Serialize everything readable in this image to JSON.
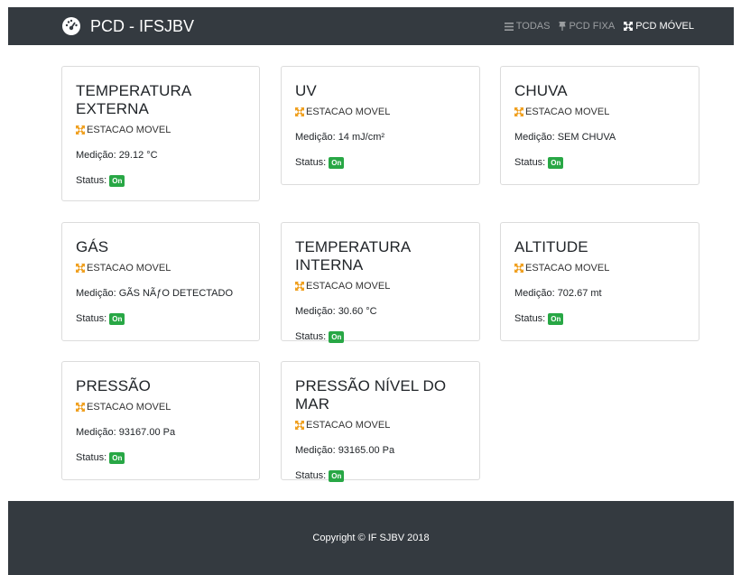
{
  "navbar": {
    "brand": "PCD - IFSJBV",
    "links": [
      {
        "label": "TODAS",
        "icon": "list-icon",
        "active": false
      },
      {
        "label": "PCD FIXA",
        "icon": "pin-icon",
        "active": false
      },
      {
        "label": "PCD MÓVEL",
        "icon": "arrows-icon",
        "active": true
      }
    ]
  },
  "cards": [
    {
      "title": "TEMPERATURA EXTERNA",
      "station": "ESTACAO MOVEL",
      "measure": "Medição: 29.12 °C",
      "status_label": "Status:",
      "status": "On"
    },
    {
      "title": "UV",
      "station": "ESTACAO MOVEL",
      "measure": "Medição: 14 mJ/cm²",
      "status_label": "Status:",
      "status": "On"
    },
    {
      "title": "CHUVA",
      "station": "ESTACAO MOVEL",
      "measure": "Medição: SEM CHUVA",
      "status_label": "Status:",
      "status": "On"
    },
    {
      "title": "GÁS",
      "station": "ESTACAO MOVEL",
      "measure": "Medição: GÃS NÃƒO DETECTADO",
      "status_label": "Status:",
      "status": "On"
    },
    {
      "title": "TEMPERATURA INTERNA",
      "station": "ESTACAO MOVEL",
      "measure": "Medição: 30.60 °C",
      "status_label": "Status:",
      "status": "On"
    },
    {
      "title": "ALTITUDE",
      "station": "ESTACAO MOVEL",
      "measure": "Medição: 702.67 mt",
      "status_label": "Status:",
      "status": "On"
    },
    {
      "title": "PRESSÃO",
      "station": "ESTACAO MOVEL",
      "measure": "Medição: 93167.00 Pa",
      "status_label": "Status:",
      "status": "On"
    },
    {
      "title": "PRESSÃO NÍVEL DO MAR",
      "station": "ESTACAO MOVEL",
      "measure": "Medição: 93165.00 Pa",
      "status_label": "Status:",
      "status": "On"
    }
  ],
  "colors": {
    "navbar_bg": "#343a40",
    "station_icon": "#f0a020",
    "badge_green": "#28a745"
  },
  "footer": {
    "text": "Copyright © IF SJBV 2018"
  }
}
